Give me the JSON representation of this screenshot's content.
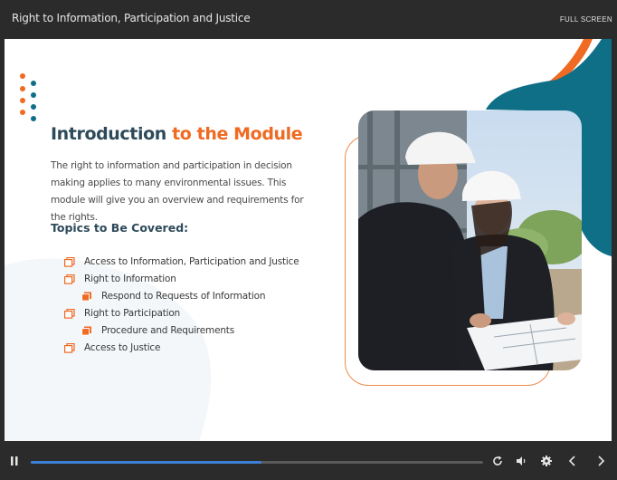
{
  "window": {
    "title": "Right to Information, Participation and Justice",
    "fullscreen_label": "FULL SCREEN"
  },
  "slide": {
    "heading_part1": "Introduction",
    "heading_part2": "to the Module",
    "intro": "The right to information and participation in decision making applies to many environmental issues. This module will give you an overview and requirements for the rights.",
    "topics_heading": "Topics to Be Covered:",
    "topics": [
      {
        "label": "Access to Information, Participation and Justice",
        "level": 1
      },
      {
        "label": "Right to Information",
        "level": 1
      },
      {
        "label": "Respond to Requests of Information",
        "level": 2
      },
      {
        "label": "Right to Participation",
        "level": 1
      },
      {
        "label": "Procedure and Requirements",
        "level": 2
      },
      {
        "label": "Access to Justice",
        "level": 1
      }
    ]
  },
  "player": {
    "progress": 0.51,
    "controls": [
      "pause-icon",
      "replay-icon",
      "volume-icon",
      "settings-icon",
      "prev-icon",
      "next-icon"
    ]
  },
  "colors": {
    "accent_orange": "#ef6a22",
    "teal": "#0f6f86",
    "navy_text": "#2e4a5a",
    "progress_blue": "#3d7fd6"
  }
}
